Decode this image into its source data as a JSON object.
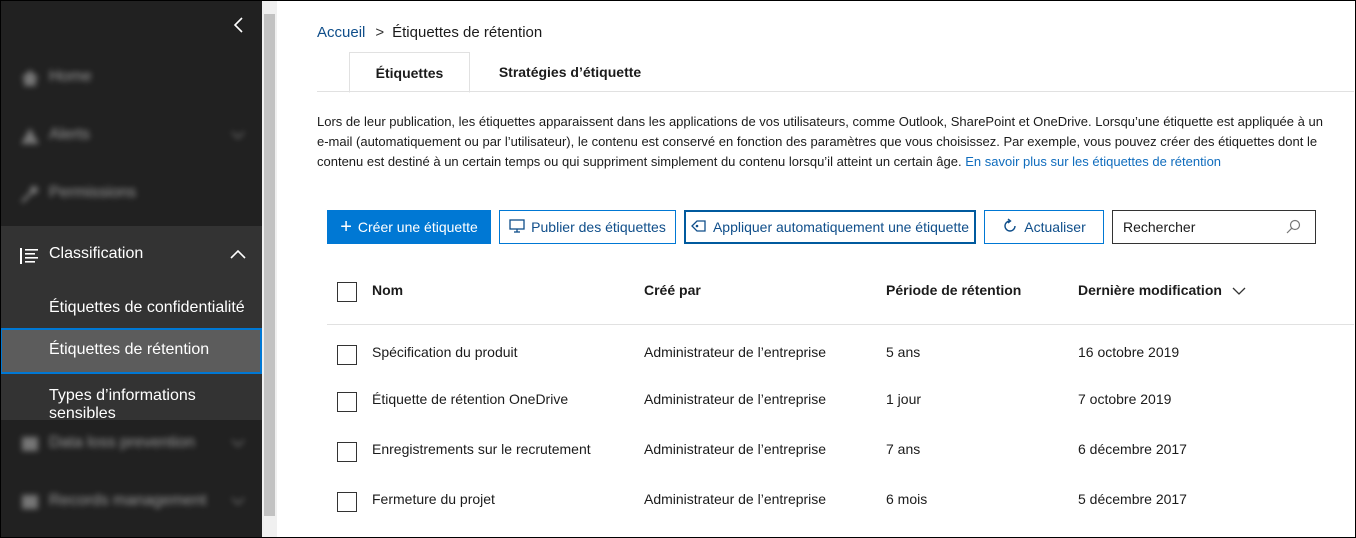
{
  "sidebar": {
    "blurred_items": [
      {
        "label": "Home",
        "icon": "home-icon"
      },
      {
        "label": "Alerts",
        "icon": "alert-icon"
      },
      {
        "label": "Permissions",
        "icon": "key-icon"
      }
    ],
    "classification": {
      "label": "Classification",
      "icon": "list-icon",
      "subitems": [
        {
          "label": "Étiquettes de confidentialité"
        },
        {
          "label": "Étiquettes de rétention"
        },
        {
          "label": "Types d’informations sensibles"
        }
      ]
    },
    "blurred_items_bottom": [
      {
        "label": "Data loss prevention"
      },
      {
        "label": "Records management"
      }
    ]
  },
  "breadcrumb": {
    "home": "Accueil",
    "separator": ">",
    "current": "Étiquettes de rétention"
  },
  "tabs": [
    {
      "label": "Étiquettes",
      "active": true
    },
    {
      "label": "Stratégies d’étiquette",
      "active": false
    }
  ],
  "description": {
    "text": "Lors de leur publication, les étiquettes apparaissent dans les applications de vos utilisateurs, comme Outlook, SharePoint et OneDrive. Lorsqu’une étiquette est appliquée à un e-mail (automatiquement ou par l’utilisateur), le contenu est conservé en fonction des paramètres que vous choisissez. Par exemple, vous pouvez créer des étiquettes dont le contenu est destiné à un certain temps ou qui suppriment simplement du contenu lorsqu’il atteint un certain âge. ",
    "link": "En savoir plus sur les étiquettes de rétention"
  },
  "toolbar": {
    "create": "Créer une étiquette",
    "publish": "Publier des étiquettes",
    "auto_apply": "Appliquer automatiquement une étiquette",
    "refresh": "Actualiser",
    "search_placeholder": "Rechercher"
  },
  "table": {
    "columns": [
      "Nom",
      "Créé par",
      "Période de rétention",
      "Dernière modification"
    ],
    "rows": [
      [
        "Spécification du produit",
        "Administrateur de l’entreprise",
        "5 ans",
        "16 octobre 2019"
      ],
      [
        "Étiquette de rétention OneDrive",
        "Administrateur de l’entreprise",
        "1 jour",
        "7 octobre 2019"
      ],
      [
        "Enregistrements sur le recrutement",
        "Administrateur de l’entreprise",
        "7 ans",
        "6 décembre 2017"
      ],
      [
        "Fermeture du projet",
        "Administrateur de l’entreprise",
        "6 mois",
        "5 décembre 2017"
      ]
    ]
  },
  "colors": {
    "accent": "#0078d4",
    "sidebar_bg": "#212121",
    "link": "#0f6cbd"
  }
}
